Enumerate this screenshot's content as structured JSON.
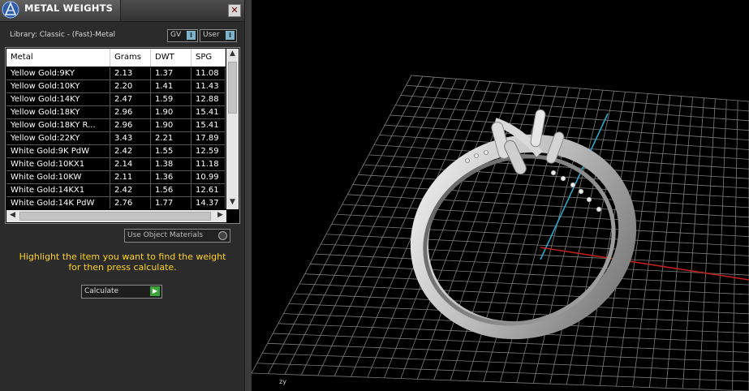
{
  "panel": {
    "title": "METAL WEIGHTS",
    "close_glyph": "✕",
    "library_label": "Library: Classic - (Fast)-Metal",
    "toggles": [
      {
        "label": "GV",
        "indicator": "I"
      },
      {
        "label": "User",
        "indicator": "I"
      }
    ],
    "table": {
      "headers": [
        "Metal",
        "Grams",
        "DWT",
        "SPG"
      ],
      "rows": [
        [
          "Yellow Gold:9KY",
          "2.13",
          "1.37",
          "11.08"
        ],
        [
          "Yellow Gold:10KY",
          "2.20",
          "1.41",
          "11.43"
        ],
        [
          "Yellow Gold:14KY",
          "2.47",
          "1.59",
          "12.88"
        ],
        [
          "Yellow Gold:18KY",
          "2.96",
          "1.90",
          "15.41"
        ],
        [
          "Yellow Gold:18KY R...",
          "2.96",
          "1.90",
          "15.41"
        ],
        [
          "Yellow Gold:22KY",
          "3.43",
          "2.21",
          "17.89"
        ],
        [
          "White Gold:9K PdW",
          "2.42",
          "1.55",
          "12.59"
        ],
        [
          "White Gold:10KX1",
          "2.14",
          "1.38",
          "11.18"
        ],
        [
          "White Gold:10KW",
          "2.11",
          "1.36",
          "10.99"
        ],
        [
          "White Gold:14KX1",
          "2.42",
          "1.56",
          "12.61"
        ],
        [
          "White Gold:14K PdW",
          "2.76",
          "1.77",
          "14.37"
        ]
      ]
    },
    "use_object_materials_label": "Use Object Materials",
    "hint_text": "Highlight the item you want to find the weight for then press calculate.",
    "calculate_label": "Calculate"
  },
  "viewport": {
    "axis_indicator": "zy",
    "grid_axis_colors": {
      "x": "#c0201a",
      "y": "#2aa7c9",
      "grid": "#8a8a8a"
    }
  },
  "icons": {
    "logo": "matrix-logo-icon",
    "close": "close-icon",
    "scroll_up": "chevron-up-icon",
    "scroll_down": "chevron-down-icon",
    "scroll_left": "chevron-left-icon",
    "scroll_right": "chevron-right-icon",
    "calculate": "play-arrow-icon"
  }
}
